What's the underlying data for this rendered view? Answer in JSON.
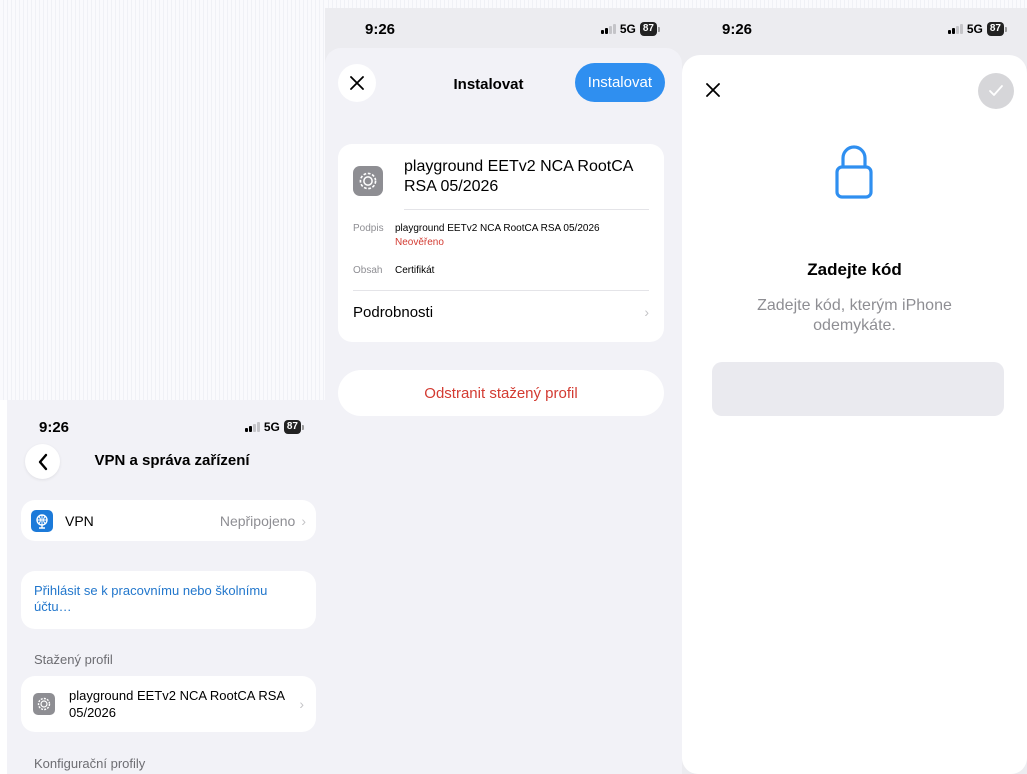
{
  "status": {
    "time": "9:26",
    "network": "5G",
    "battery": "87"
  },
  "vpn_screen": {
    "title": "VPN a správa zařízení",
    "vpn_label": "VPN",
    "vpn_status": "Nepřipojeno",
    "login_link": "Přihlásit se k pracovnímu nebo školnímu účtu…",
    "downloaded_header": "Stažený profil",
    "profile_name": "playground EETv2 NCA RootCA RSA 05/2026",
    "config_header": "Konfigurační profily"
  },
  "install_screen": {
    "title": "Instalovat",
    "install_button": "Instalovat",
    "profile_name": "playground EETv2 NCA RootCA RSA 05/2026",
    "signed_key": "Podpis",
    "signed_value": "playground EETv2 NCA RootCA RSA 05/2026",
    "unverified": "Neověřeno",
    "contains_key": "Obsah",
    "contains_value": "Certifikát",
    "details": "Podrobnosti",
    "remove": "Odstranit stažený profil"
  },
  "passcode_screen": {
    "title": "Zadejte kód",
    "subtitle": "Zadejte kód, kterým iPhone odemykáte."
  },
  "colors": {
    "accent": "#2f8ff0",
    "destructive": "#d33b32",
    "vpn_icon": "#1c7ad9",
    "lock": "#2f8ff0"
  },
  "icons": [
    "back-chevron-icon",
    "vpn-globe-icon",
    "chevron-right-icon",
    "gear-icon",
    "close-icon",
    "checkmark-icon",
    "lock-icon",
    "signal-icon",
    "battery-icon"
  ]
}
